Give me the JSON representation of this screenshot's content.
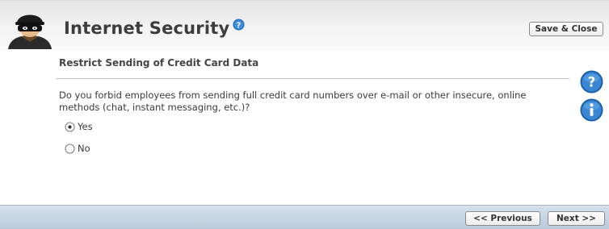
{
  "header": {
    "title": "Internet Security",
    "save_close_label": "Save & Close"
  },
  "section": {
    "title": "Restrict Sending of Credit Card Data"
  },
  "question": {
    "text": "Do you forbid employees from sending full credit card numbers over e-mail or other insecure, online methods (chat, instant messaging, etc.)?",
    "options": [
      {
        "label": "Yes",
        "selected": true
      },
      {
        "label": "No",
        "selected": false
      }
    ]
  },
  "footer": {
    "previous_label": "<< Previous",
    "next_label": "Next >>"
  },
  "icons": {
    "avatar": "masked-burglar-icon",
    "title_help": "help-icon",
    "side_help": "help-icon",
    "side_info": "info-icon"
  },
  "colors": {
    "help_blue": "#1f6fbf",
    "footer_blue": "#c4d4e4",
    "title_text": "#3d3d3d"
  }
}
